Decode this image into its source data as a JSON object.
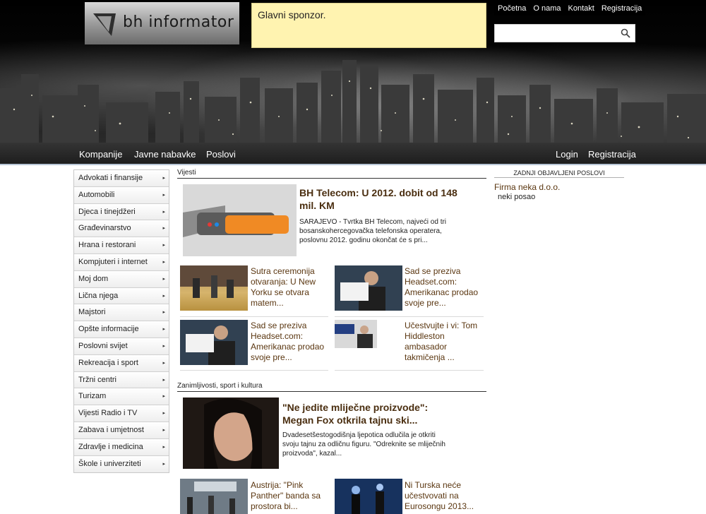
{
  "header": {
    "logo_text": "bh informator",
    "sponsor_text": "Glavni sponzor.",
    "top_links": [
      "Početna",
      "O nama",
      "Kontakt",
      "Registracija"
    ],
    "search_placeholder": ""
  },
  "navbar": {
    "left": [
      "Kompanije",
      "Javne nabavke",
      "Poslovi"
    ],
    "right": [
      "Login",
      "Registracija"
    ]
  },
  "sidebar": {
    "items": [
      "Advokati i finansije",
      "Automobili",
      "Djeca i tinejdžeri",
      "Građevinarstvo",
      "Hrana i restorani",
      "Kompjuteri i internet",
      "Moj dom",
      "Lična njega",
      "Majstori",
      "Opšte informacije",
      "Poslovni svijet",
      "Rekreacija i sport",
      "Tržni centri",
      "Turizam",
      "Vijesti Radio i TV",
      "Zabava i umjetnost",
      "Zdravlje i medicina",
      "Škole i univerziteti"
    ]
  },
  "news": {
    "section_title": "Vijesti",
    "featured": {
      "title": "BH Telecom: U 2012. dobit od 148 mil. KM",
      "text": "SARAJEVO - Tvrtka BH Telecom, najveći od tri bosanskohercegovačka telefonska operatera, poslovnu 2012. godinu okončat će s pri..."
    },
    "items": [
      "Sutra ceremonija otvaranja: U New Yorku se otvara matem...",
      "Sad se preziva Headset.com: Amerikanac prodao svoje pre...",
      "Sad se preziva Headset.com: Amerikanac prodao svoje pre...",
      "Učestvujte i vi: Tom Hiddleston ambasador takmičenja ..."
    ]
  },
  "culture": {
    "section_title": "Zanimljivosti, sport i kultura",
    "featured": {
      "title": "\"Ne jedite mliječne proizvode\": Megan Fox otkrila tajnu ski...",
      "text": "Dvadesetšestogodišnja ljepotica odlučila je otkriti svoju tajnu za odličnu figuru. \"Odreknite se mliječnih proizvoda\", kazal..."
    },
    "items": [
      "Austrija: \"Pink Panther\" banda sa prostora bi...",
      "Ni Turska neće učestvovati na Eurosongu 2013..."
    ]
  },
  "jobs": {
    "section_title": "ZADNJI OBJAVLJENI POSLOVI",
    "company": "Firma neka d.o.o.",
    "job": "neki posao"
  }
}
